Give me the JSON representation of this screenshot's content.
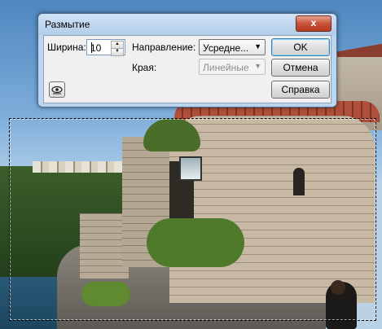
{
  "dialog": {
    "title": "Размытие",
    "close_label": "x",
    "width_label": "Ширина:",
    "width_value": "10",
    "direction_label": "Направление:",
    "direction_value": "Усредне...",
    "edges_label": "Края:",
    "edges_value": "Линейные",
    "ok_label": "OK",
    "cancel_label": "Отмена",
    "help_label": "Справка",
    "preview_icon": "eye-icon"
  },
  "colors": {
    "dialog_frame": "#bdd6ef",
    "close_button": "#c8523a"
  }
}
